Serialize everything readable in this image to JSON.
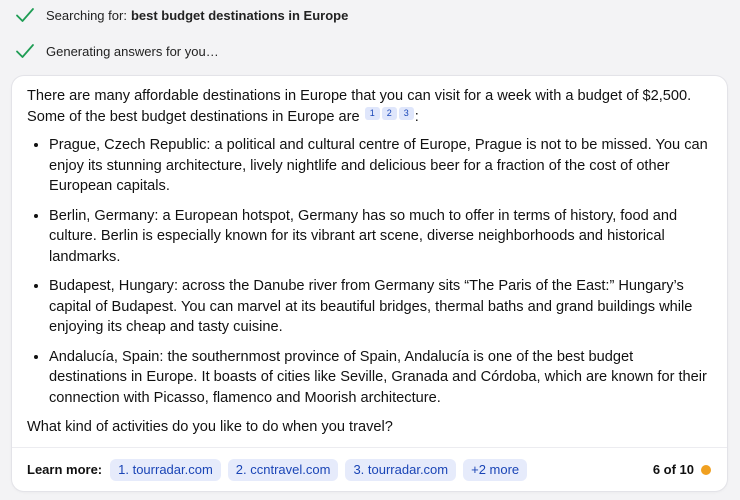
{
  "status": [
    {
      "prefix": "Searching for:",
      "query": "best budget destinations in Europe"
    },
    {
      "prefix": "Generating answers for you…",
      "query": ""
    }
  ],
  "answer": {
    "intro": "There are many affordable destinations in Europe that you can visit for a week with a budget of $2,500. Some of the best budget destinations in Europe are",
    "citations": [
      "1",
      "2",
      "3"
    ],
    "intro_end": ":",
    "points": [
      "Prague, Czech Republic: a political and cultural centre of Europe, Prague is not to be missed. You can enjoy its stunning architecture, lively nightlife and delicious beer for a fraction of the cost of other European capitals.",
      "Berlin, Germany: a European hotspot, Germany has so much to offer in terms of history, food and culture. Berlin is especially known for its vibrant art scene, diverse neighborhoods and historical landmarks.",
      "Budapest, Hungary: across the Danube river from Germany sits “The Paris of the East:” Hungary’s capital of Budapest. You can marvel at its beautiful bridges, thermal baths and grand buildings while enjoying its cheap and tasty cuisine.",
      "Andalucía, Spain: the southernmost province of Spain, Andalucía is one of the best budget destinations in Europe. It boasts of cities like Seville, Granada and Córdoba, which are known for their connection with Picasso, flamenco and Moorish architecture."
    ],
    "closing": "What kind of activities do you like to do when you travel?"
  },
  "footer": {
    "learn_more_label": "Learn more:",
    "links": [
      "1. tourradar.com",
      "2. ccntravel.com",
      "3. tourradar.com"
    ],
    "more_label": "+2 more",
    "counter": "6 of 10"
  },
  "colors": {
    "check": "#1f9d55",
    "chip_bg": "#e6ebfb",
    "chip_text": "#1a45b6",
    "dot": "#f0a020"
  },
  "icons": {
    "status": "checkmark-icon",
    "counter": "status-dot-icon"
  }
}
